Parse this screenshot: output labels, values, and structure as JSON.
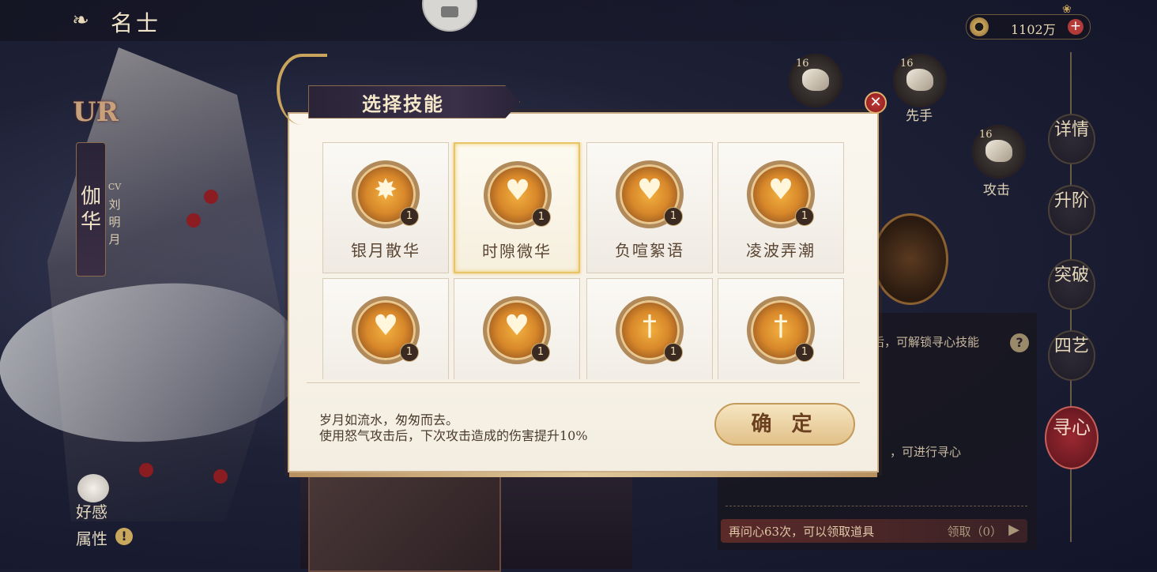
{
  "header": {
    "back_icon": "back-swirl-icon",
    "title": "名士",
    "currency_icon": "coin-icon",
    "currency_value": "1102万",
    "add_icon_symbol": "+"
  },
  "character": {
    "rarity": "UR",
    "name": "伽华",
    "cv_label": "CV",
    "cv_name": "刘明月",
    "affinity_label": "好感",
    "attribute_label": "属性",
    "info_symbol": "!"
  },
  "right_panel": {
    "skills": [
      {
        "level": "16",
        "label": ""
      },
      {
        "level": "16",
        "label": "先手"
      },
      {
        "level": "16",
        "label": "攻击"
      }
    ],
    "unlock_hint": "后，可解锁寻心技能",
    "help_symbol": "?",
    "hint_available": "，可进行寻心",
    "reward_text": "再问心63次，可以领取道具",
    "reward_claim": "领取（0）",
    "nav": [
      {
        "label": "详情"
      },
      {
        "label": "升阶"
      },
      {
        "label": "突破"
      },
      {
        "label": "四艺"
      },
      {
        "label": "寻心"
      }
    ]
  },
  "modal": {
    "title": "选择技能",
    "close_symbol": "✕",
    "skills": [
      {
        "name": "银月散华",
        "count": "1",
        "glyph": "✸"
      },
      {
        "name": "时隙微华",
        "count": "1",
        "glyph": "♥"
      },
      {
        "name": "负喧絮语",
        "count": "1",
        "glyph": "♥"
      },
      {
        "name": "凌波弄潮",
        "count": "1",
        "glyph": "♥"
      },
      {
        "name": "",
        "count": "1",
        "glyph": "♥"
      },
      {
        "name": "",
        "count": "1",
        "glyph": "♥"
      },
      {
        "name": "",
        "count": "1",
        "glyph": "†"
      },
      {
        "name": "",
        "count": "1",
        "glyph": "†"
      }
    ],
    "selected_index": 1,
    "description_line1": "岁月如流水，匆匆而去。",
    "description_line2": "使用怒气攻击后，下次攻击造成的伤害提升10%",
    "confirm_label": "确 定"
  }
}
